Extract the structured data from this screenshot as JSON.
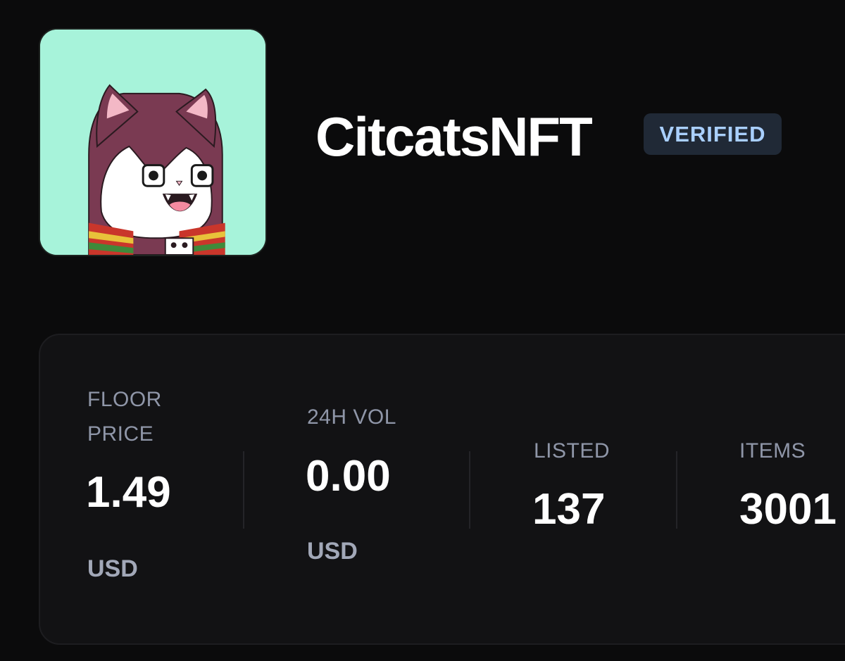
{
  "collection": {
    "name": "CitcatsNFT",
    "badge": "VERIFIED",
    "avatar_icon": "cat-avatar-image",
    "colors": {
      "avatar_background": "#a7f3da",
      "badge_background": "#202936",
      "badge_text": "#a9cfff"
    }
  },
  "stats": {
    "floor": {
      "label_line1": "FLOOR",
      "label_line2": "PRICE",
      "value": "1.49",
      "unit": "USD"
    },
    "volume": {
      "label": "24H VOL",
      "value": "0.00",
      "unit": "USD"
    },
    "listed": {
      "label": "LISTED",
      "value": "137"
    },
    "items": {
      "label": "ITEMS",
      "value": "3001"
    }
  }
}
